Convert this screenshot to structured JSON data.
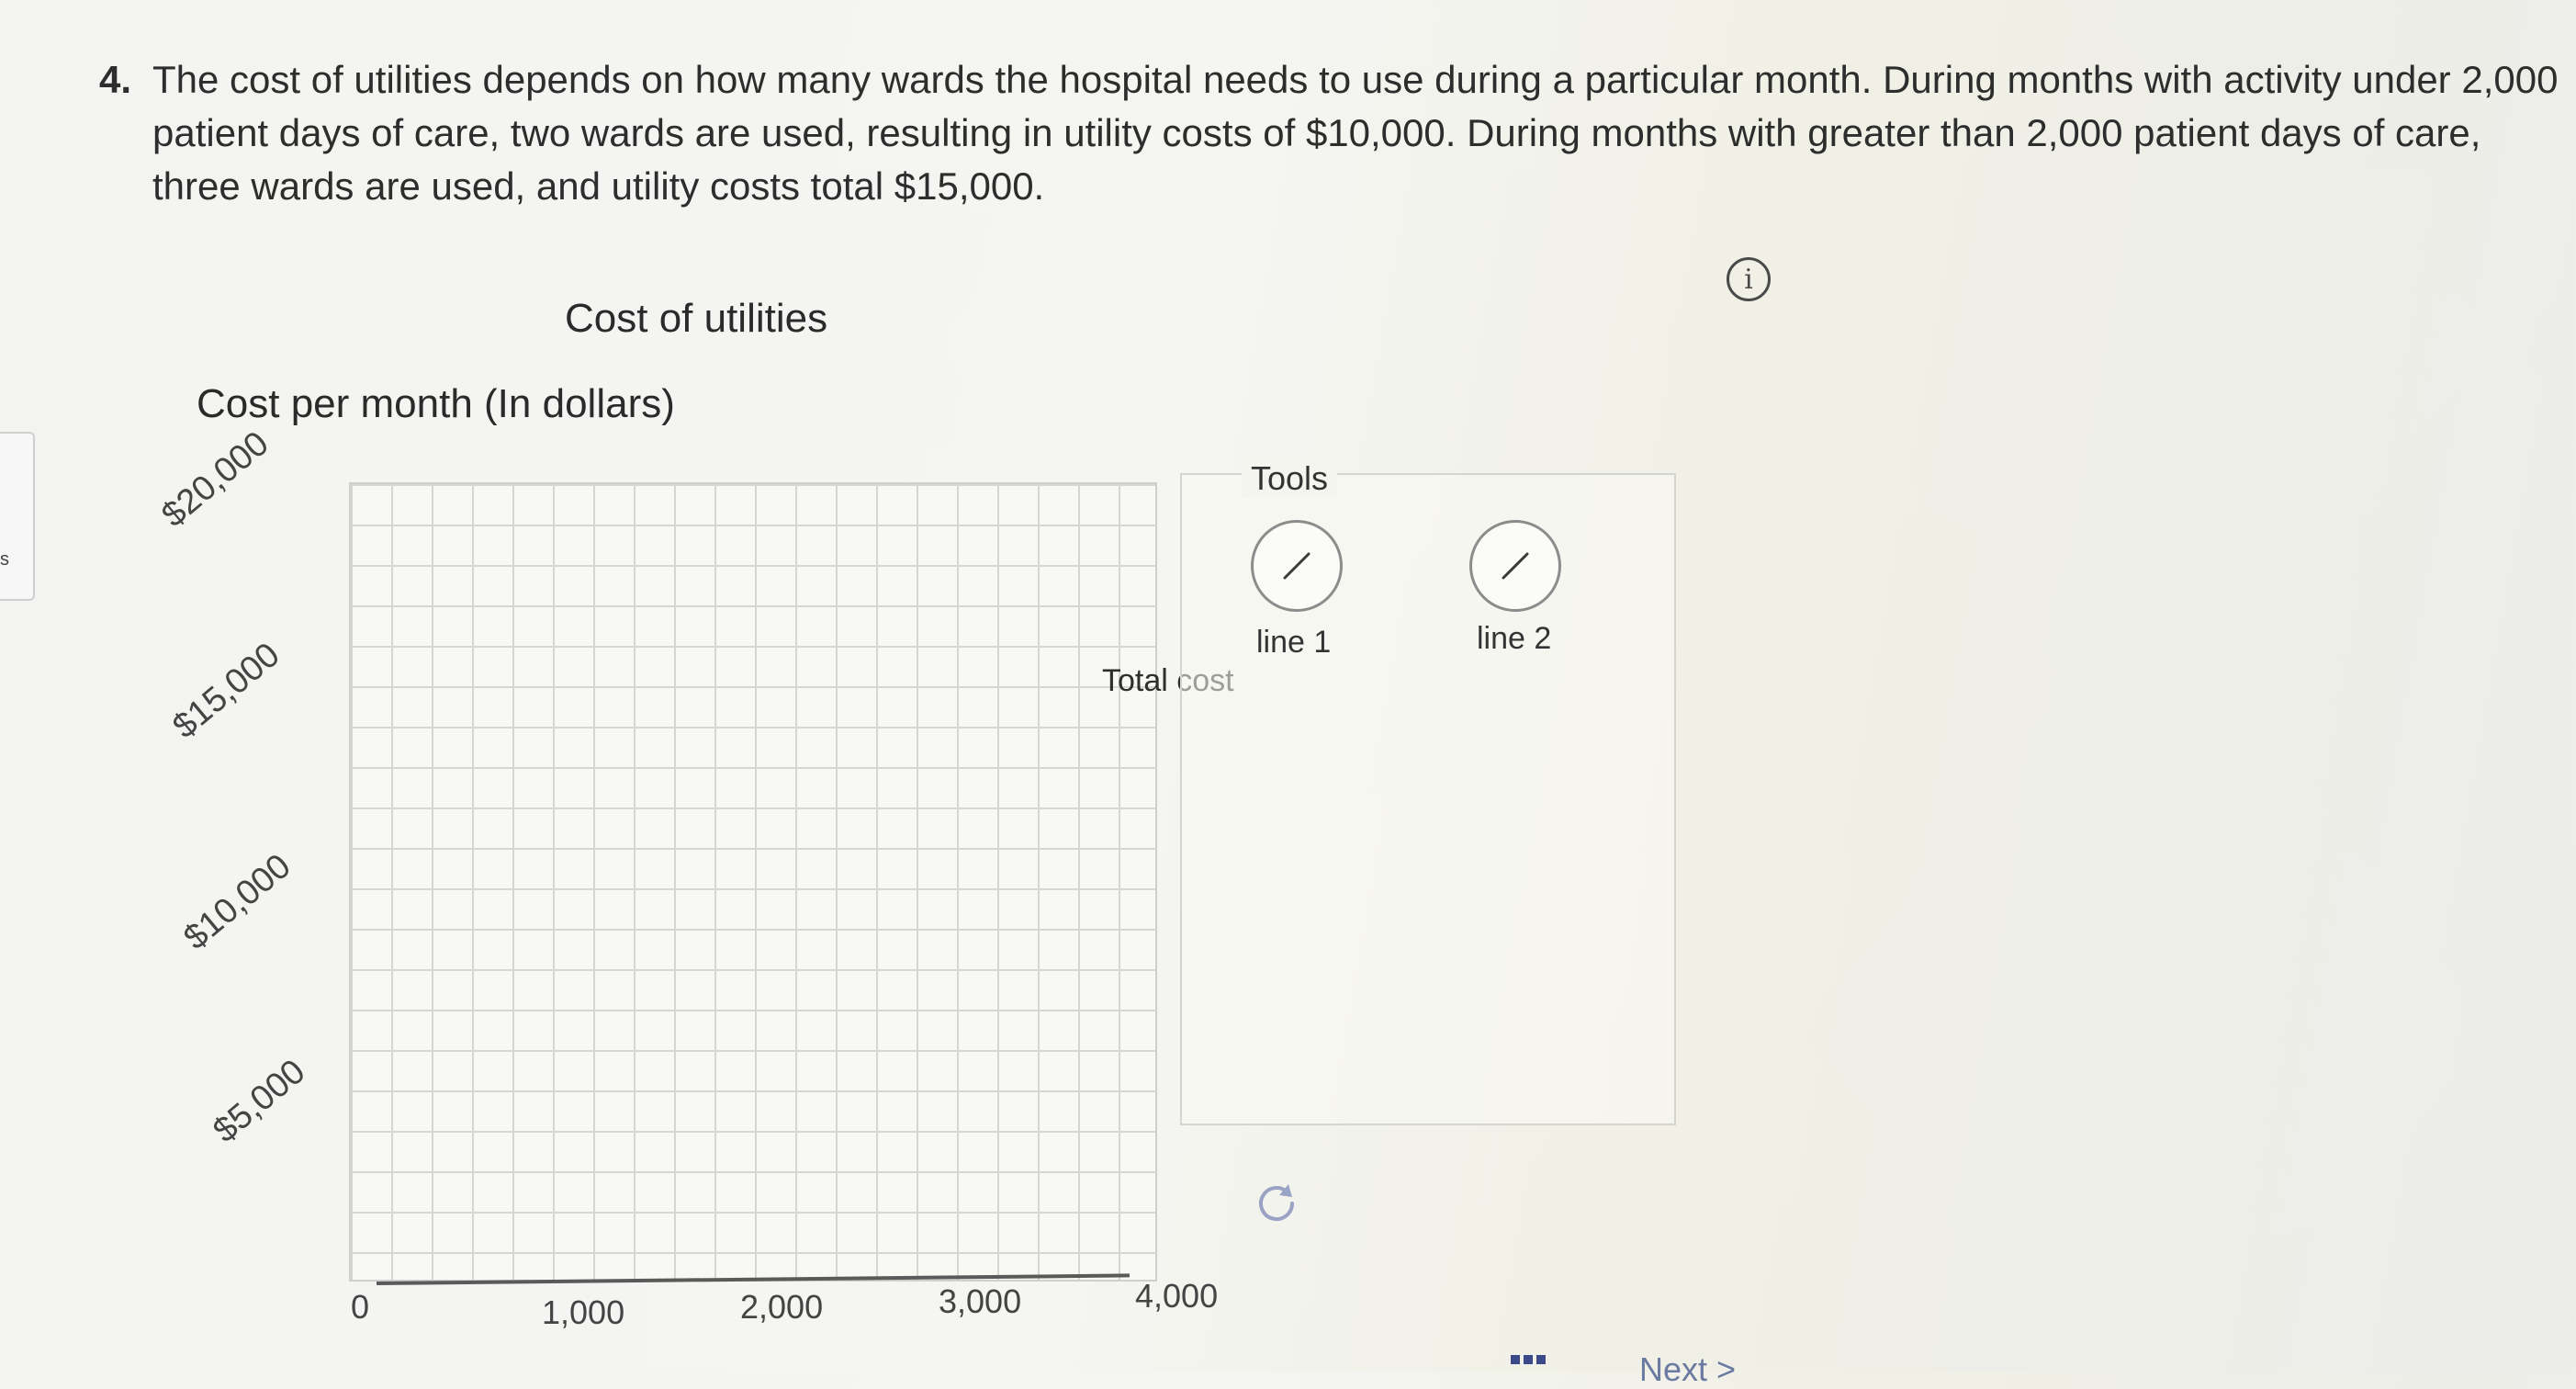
{
  "question": {
    "number": "4.",
    "text": "The cost of utilities depends on how many wards the hospital needs to use during a particular month. During months with activity under 2,000 patient days of care, two wards are used, resulting in utility costs of $10,000. During months with greater than 2,000 patient days of care, three wards are used, and utility costs total $15,000."
  },
  "chart": {
    "title": "Cost of utilities",
    "y_title": "Cost per month (In dollars)",
    "line_label": "Total cost"
  },
  "tools": {
    "label": "Tools",
    "items": [
      {
        "label": "line 1",
        "icon": "line-draw-icon"
      },
      {
        "label": "line 2",
        "icon": "line-draw-icon"
      }
    ]
  },
  "side_tab_label": "s",
  "footer": {
    "next_label": "Next >"
  },
  "chart_data": {
    "type": "line",
    "title": "Cost of utilities",
    "ylabel": "Cost per month (In dollars)",
    "xlabel": "",
    "x_ticks": [
      "0",
      "1,000",
      "2,000",
      "3,000",
      "4,000"
    ],
    "y_ticks": [
      "$5,000",
      "$10,000",
      "$15,000",
      "$20,000"
    ],
    "xlim": [
      0,
      4000
    ],
    "ylim": [
      0,
      20000
    ],
    "grid": true,
    "series": []
  }
}
